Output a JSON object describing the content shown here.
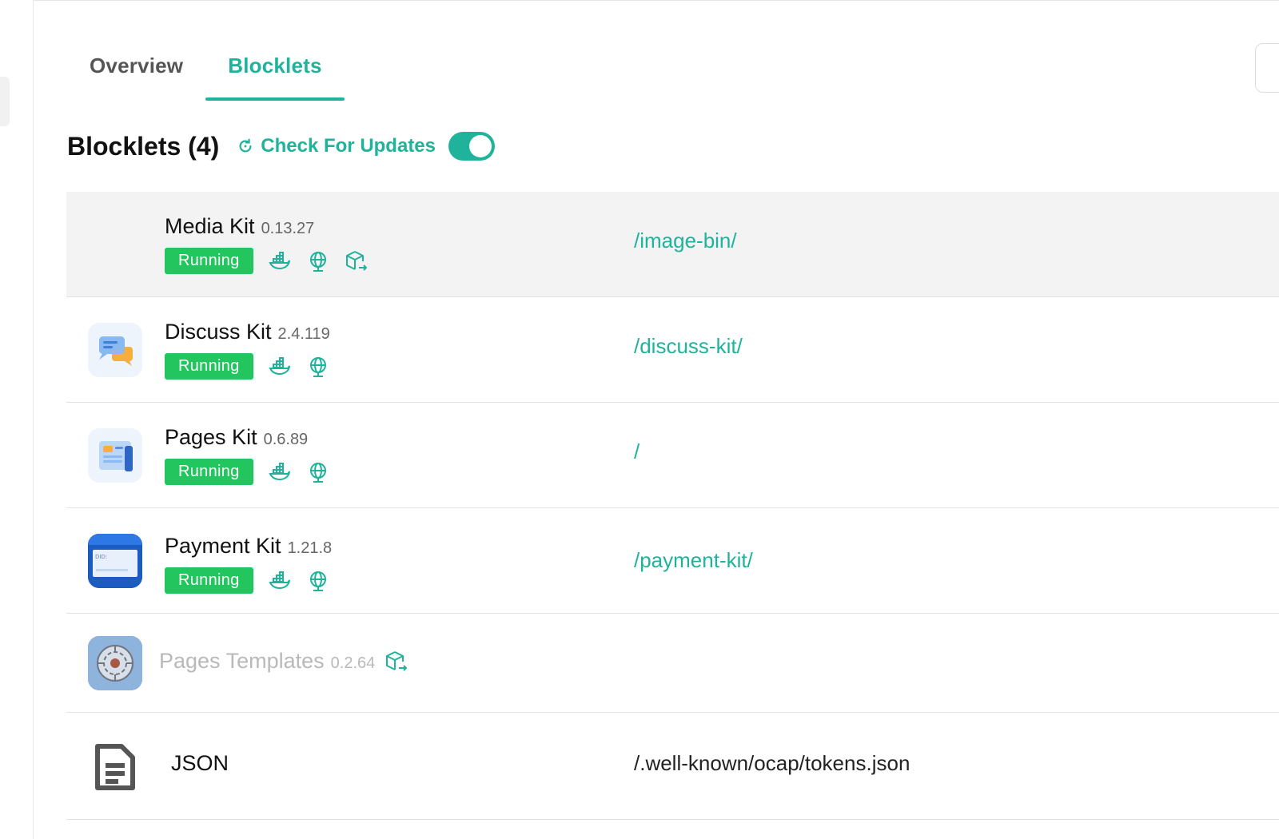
{
  "tabs": [
    {
      "label": "Overview",
      "active": false
    },
    {
      "label": "Blocklets",
      "active": true
    }
  ],
  "section": {
    "title": "Blocklets (4)",
    "check_updates_label": "Check For Updates",
    "toggle_on": true
  },
  "colors": {
    "accent": "#1fb39b",
    "running": "#22c55e",
    "hover_row": "#f3f3f3"
  },
  "rows": [
    {
      "name": "Media Kit",
      "version": "0.13.27",
      "status": "Running",
      "mount": "/image-bin/",
      "icons": [
        "docker-icon",
        "globe-icon",
        "package-export-icon"
      ]
    },
    {
      "name": "Discuss Kit",
      "version": "2.4.119",
      "status": "Running",
      "mount": "/discuss-kit/",
      "icons": [
        "docker-icon",
        "globe-icon"
      ]
    },
    {
      "name": "Pages Kit",
      "version": "0.6.89",
      "status": "Running",
      "mount": "/",
      "icons": [
        "docker-icon",
        "globe-icon"
      ]
    },
    {
      "name": "Payment Kit",
      "version": "1.21.8",
      "status": "Running",
      "mount": "/payment-kit/",
      "icons": [
        "docker-icon",
        "globe-icon"
      ],
      "icon_text": "DID:"
    },
    {
      "name": "Pages Templates",
      "version": "0.2.64",
      "status": "",
      "mount": "",
      "icons": [
        "package-export-icon"
      ]
    },
    {
      "name": "JSON",
      "version": "",
      "status": "",
      "mount": "/.well-known/ocap/tokens.json",
      "icons": []
    }
  ]
}
